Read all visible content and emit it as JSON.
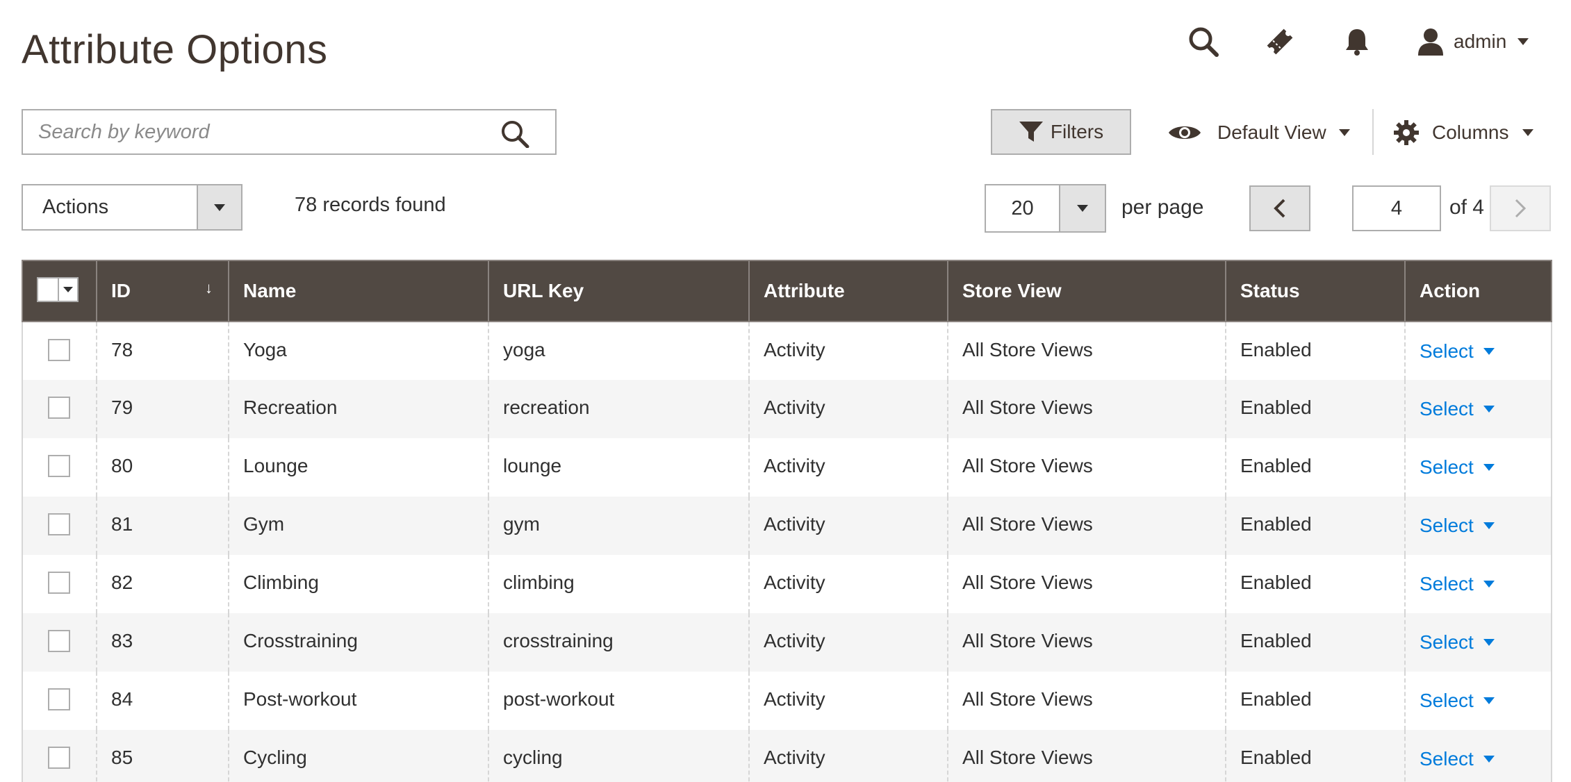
{
  "page": {
    "title": "Attribute Options"
  },
  "header": {
    "user_name": "admin"
  },
  "search": {
    "placeholder": "Search by keyword",
    "value": ""
  },
  "toolbar": {
    "filters_label": "Filters",
    "view_label": "Default View",
    "columns_label": "Columns",
    "actions_label": "Actions",
    "records_found": "78 records found",
    "per_page_value": "20",
    "per_page_label": "per page",
    "current_page": "4",
    "of_pages": "of 4"
  },
  "grid": {
    "columns": [
      "ID",
      "Name",
      "URL Key",
      "Attribute",
      "Store View",
      "Status",
      "Action"
    ],
    "rows": [
      {
        "id": "78",
        "name": "Yoga",
        "url_key": "yoga",
        "attribute": "Activity",
        "store_view": "All Store Views",
        "status": "Enabled",
        "action": "Select"
      },
      {
        "id": "79",
        "name": "Recreation",
        "url_key": "recreation",
        "attribute": "Activity",
        "store_view": "All Store Views",
        "status": "Enabled",
        "action": "Select"
      },
      {
        "id": "80",
        "name": "Lounge",
        "url_key": "lounge",
        "attribute": "Activity",
        "store_view": "All Store Views",
        "status": "Enabled",
        "action": "Select"
      },
      {
        "id": "81",
        "name": "Gym",
        "url_key": "gym",
        "attribute": "Activity",
        "store_view": "All Store Views",
        "status": "Enabled",
        "action": "Select"
      },
      {
        "id": "82",
        "name": "Climbing",
        "url_key": "climbing",
        "attribute": "Activity",
        "store_view": "All Store Views",
        "status": "Enabled",
        "action": "Select"
      },
      {
        "id": "83",
        "name": "Crosstraining",
        "url_key": "crosstraining",
        "attribute": "Activity",
        "store_view": "All Store Views",
        "status": "Enabled",
        "action": "Select"
      },
      {
        "id": "84",
        "name": "Post-workout",
        "url_key": "post-workout",
        "attribute": "Activity",
        "store_view": "All Store Views",
        "status": "Enabled",
        "action": "Select"
      },
      {
        "id": "85",
        "name": "Cycling",
        "url_key": "cycling",
        "attribute": "Activity",
        "store_view": "All Store Views",
        "status": "Enabled",
        "action": "Select"
      }
    ]
  },
  "colors": {
    "header_bg": "#514943",
    "link": "#007bdb",
    "title": "#41362f"
  },
  "icons": [
    "search-icon",
    "ticket-icon",
    "bell-icon",
    "user-icon",
    "filter-icon",
    "eye-icon",
    "gear-icon",
    "chevron-left-icon",
    "chevron-right-icon"
  ]
}
